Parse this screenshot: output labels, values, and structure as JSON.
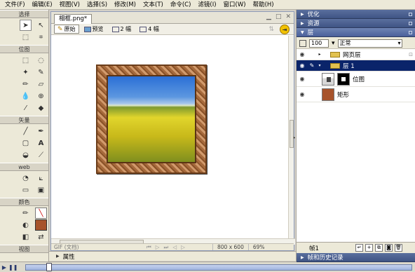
{
  "menubar": {
    "items": [
      "文件(F)",
      "编辑(E)",
      "视图(V)",
      "选择(S)",
      "修改(M)",
      "文本(T)",
      "命令(C)",
      "滤镜(I)",
      "窗口(W)",
      "帮助(H)"
    ]
  },
  "tools": {
    "sections": {
      "select": "选择",
      "bitmap": "位图",
      "vector": "矢量",
      "web": "web",
      "colors": "颜色",
      "view": "视图"
    },
    "text_tool_glyph": "A"
  },
  "document": {
    "tab": "相框.png*",
    "view_tabs": [
      "原始",
      "预览",
      "2 幅",
      "4 幅"
    ],
    "status": {
      "file_format": "GIF (文档)",
      "dimensions": "800 x 600",
      "zoom": "69%"
    }
  },
  "bottom_panel": {
    "label": "属性"
  },
  "panels": {
    "optimize": "优化",
    "assets": "资源",
    "layers": "层",
    "frames": "帧和历史记录"
  },
  "layers": {
    "opacity": "100",
    "blend_mode": "正常",
    "rows": [
      {
        "name": "网页层"
      },
      {
        "name": "层 1"
      },
      {
        "name": "位图"
      },
      {
        "name": "矩形"
      }
    ],
    "footer_frame": "帧1"
  }
}
